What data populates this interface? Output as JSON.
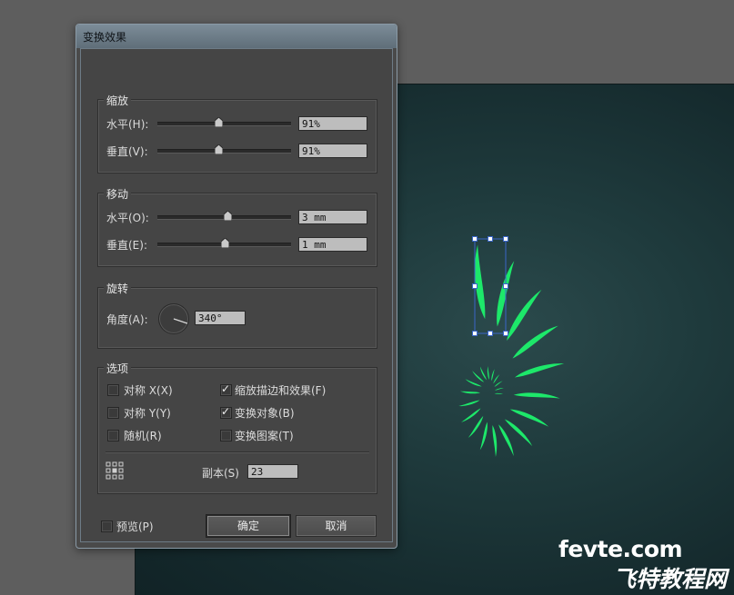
{
  "dialog": {
    "title": "变换效果",
    "scale": {
      "legend": "缩放",
      "horizontal": {
        "label": "水平(H):",
        "value": "91%",
        "slider_percent": 46
      },
      "vertical": {
        "label": "垂直(V):",
        "value": "91%",
        "slider_percent": 46
      }
    },
    "move": {
      "legend": "移动",
      "horizontal": {
        "label": "水平(O):",
        "value": "3 mm",
        "slider_percent": 53
      },
      "vertical": {
        "label": "垂直(E):",
        "value": "1 mm",
        "slider_percent": 51
      }
    },
    "rotate": {
      "legend": "旋转",
      "angle_label": "角度(A):",
      "angle_value": "340°"
    },
    "options": {
      "legend": "选项",
      "reflect_x": {
        "label": "对称 X(X)",
        "checked": false
      },
      "reflect_y": {
        "label": "对称 Y(Y)",
        "checked": false
      },
      "random": {
        "label": "随机(R)",
        "checked": false
      },
      "scale_strokes": {
        "label": "缩放描边和效果(F)",
        "checked": true
      },
      "transform_objects": {
        "label": "变换对象(B)",
        "checked": true
      },
      "transform_patterns": {
        "label": "变换图案(T)",
        "checked": false
      },
      "copies_label": "副本(S)",
      "copies_value": "23"
    },
    "preview": {
      "label": "预览(P)",
      "checked": false
    },
    "ok_label": "确定",
    "cancel_label": "取消"
  },
  "canvas": {
    "artwork_color": "#1de86a",
    "selection_color": "#3a66c8"
  },
  "watermark": {
    "line1": "fevte.com",
    "line2": "飞特教程网"
  }
}
